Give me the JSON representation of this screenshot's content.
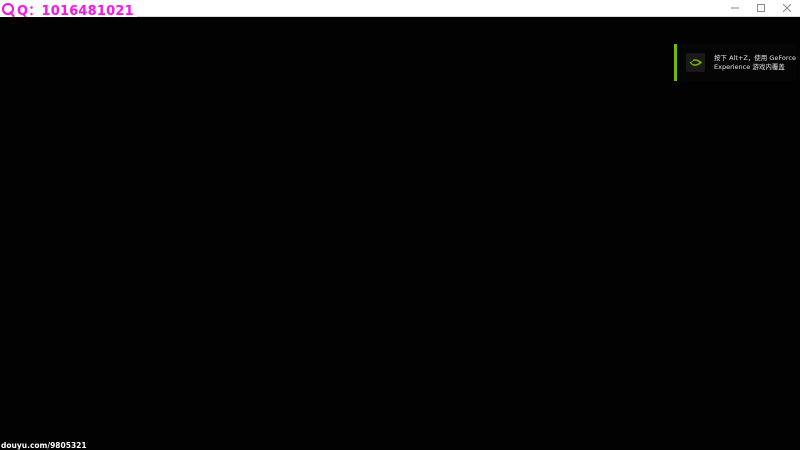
{
  "overlay": {
    "qq_prefix": "Q：",
    "qq_number": "1016481021",
    "text_color": "#f21ee0"
  },
  "window_controls": {
    "minimize_icon": "minimize-icon",
    "maximize_icon": "maximize-icon",
    "close_icon": "close-icon"
  },
  "notification": {
    "line1": "按下 Alt+Z，使用 GeForce",
    "line2": "Experience 游戏内覆盖",
    "accent_color": "#76b900",
    "icon": "nvidia-logo-icon"
  },
  "watermark": {
    "text": "douyu.com/9805321"
  }
}
